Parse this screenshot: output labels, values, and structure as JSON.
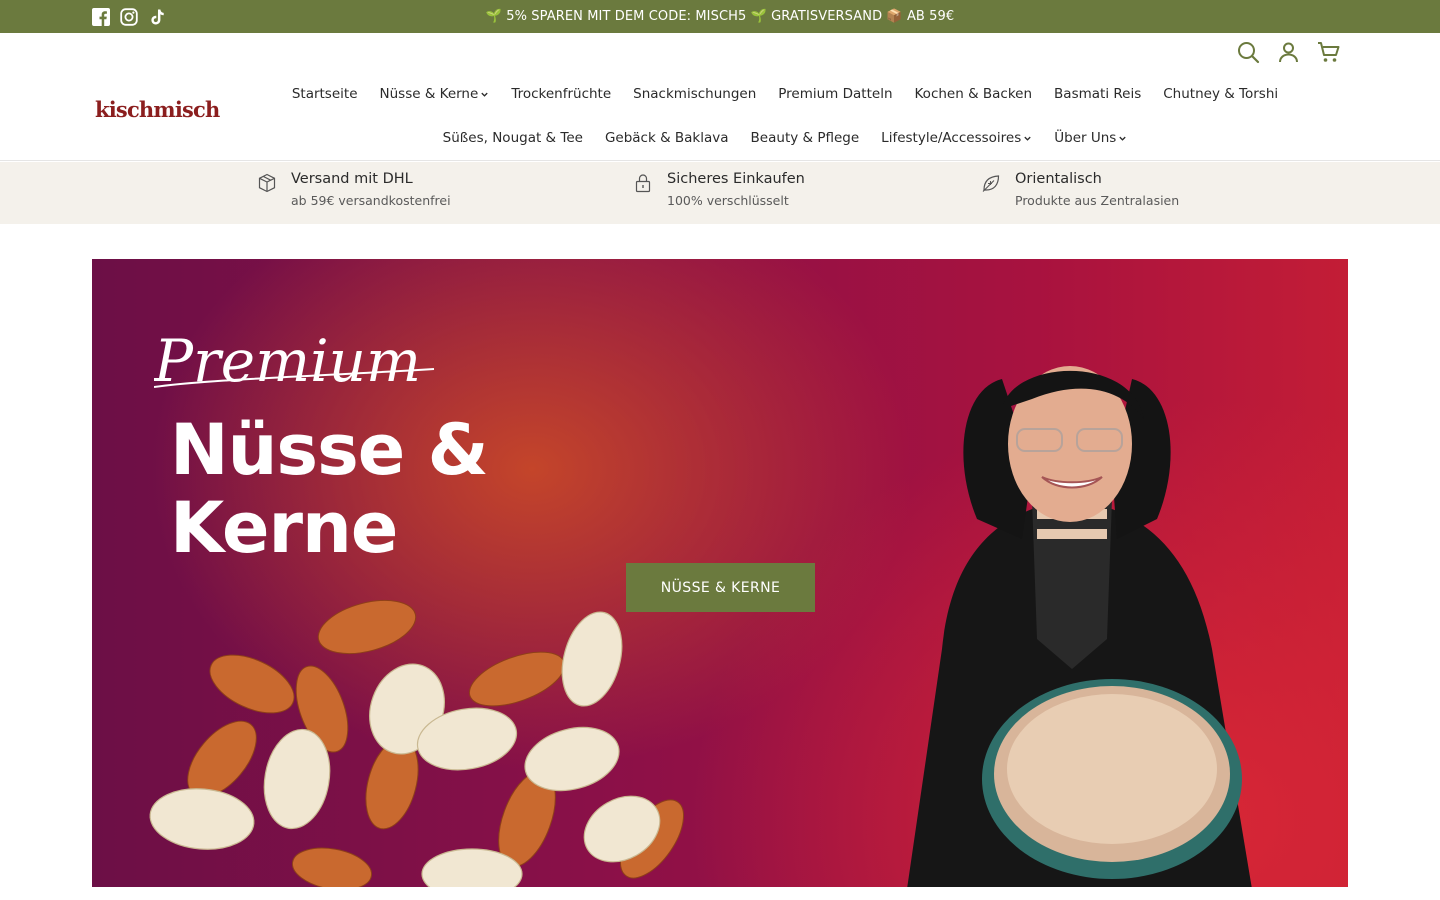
{
  "announcement": {
    "text": "🌱 5% SPAREN MIT DEM CODE: MISCH5 🌱 GRATISVERSAND 📦 AB 59€",
    "social": [
      "facebook-icon",
      "instagram-icon",
      "tiktok-icon"
    ]
  },
  "header": {
    "logo": "kischmisch",
    "icons": [
      "search-icon",
      "account-icon",
      "cart-icon"
    ],
    "nav_row1": [
      {
        "label": "Startseite"
      },
      {
        "label": "Nüsse & Kerne",
        "dropdown": true
      },
      {
        "label": "Trockenfrüchte"
      },
      {
        "label": "Snackmischungen"
      },
      {
        "label": "Premium Datteln"
      },
      {
        "label": "Kochen & Backen"
      },
      {
        "label": "Basmati Reis"
      },
      {
        "label": "Chutney & Torshi"
      }
    ],
    "nav_row2": [
      {
        "label": "Süßes, Nougat & Tee"
      },
      {
        "label": "Gebäck & Baklava"
      },
      {
        "label": "Beauty & Pflege"
      },
      {
        "label": "Lifestyle/Accessoires",
        "dropdown": true
      },
      {
        "label": "Über Uns",
        "dropdown": true
      }
    ]
  },
  "usp": [
    {
      "icon": "box-icon",
      "title": "Versand mit DHL",
      "sub": "ab 59€ versandkostenfrei"
    },
    {
      "icon": "lock-icon",
      "title": "Sicheres Einkaufen",
      "sub": "100% verschlüsselt"
    },
    {
      "icon": "leaf-icon",
      "title": "Orientalisch",
      "sub": "Produkte aus Zentralasien"
    }
  ],
  "hero": {
    "script_text": "Premium",
    "title_line1": "Nüsse &",
    "title_line2": "Kerne",
    "button_label": "NÜSSE & KERNE"
  },
  "colors": {
    "brand_green": "#6b7a3e",
    "logo_red": "#8b1e1e",
    "usp_bg": "#f4f1eb"
  }
}
